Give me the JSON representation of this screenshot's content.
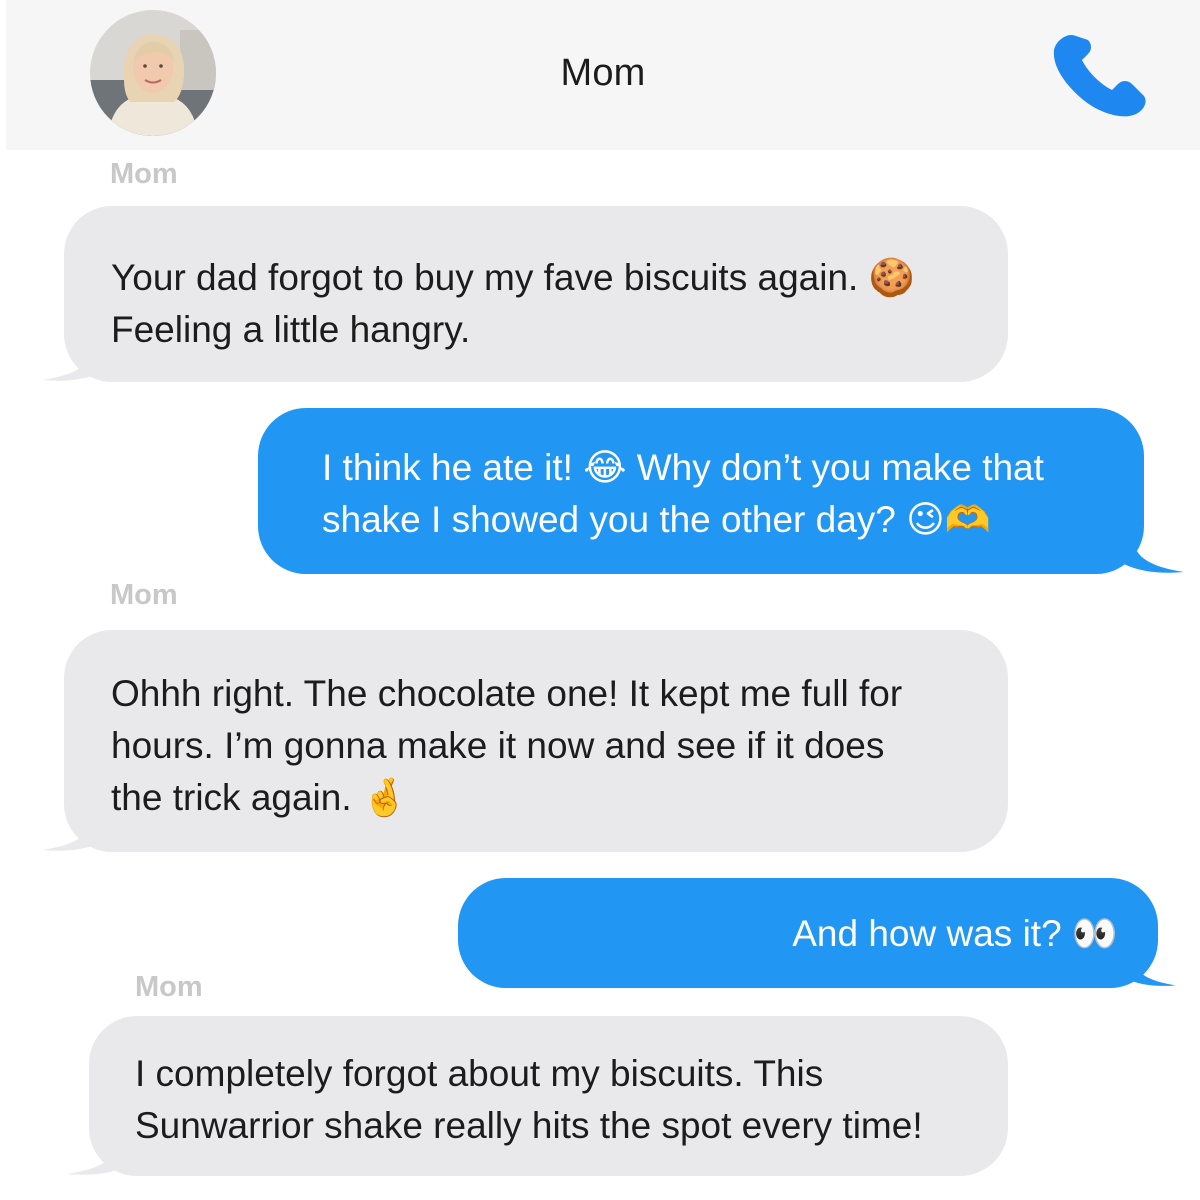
{
  "header": {
    "contact_name": "Mom",
    "call_icon": "phone-icon",
    "avatar_icon": "avatar-photo"
  },
  "colors": {
    "header_bg": "#f6f6f6",
    "received_bubble": "#e9e9eb",
    "sent_bubble": "#2196f3",
    "sender_label": "#c8c8c8",
    "call_icon": "#1e88f0"
  },
  "messages": [
    {
      "direction": "received",
      "sender": "Mom",
      "text": "Your dad forgot to buy my fave biscuits again. 🍪\nFeeling a little hangry."
    },
    {
      "direction": "sent",
      "text": "I think he ate it! 😂 Why don’t you make that\nshake I showed you the other day? 😉🫶"
    },
    {
      "direction": "received",
      "sender": "Mom",
      "text": "Ohhh right. The chocolate one! It kept me full for\nhours. I’m gonna make it now and see if it does\nthe trick again. 🤞"
    },
    {
      "direction": "sent",
      "text": "And how was it? 👀"
    },
    {
      "direction": "received",
      "sender": "Mom",
      "text": " I completely forgot about my biscuits. This\nSunwarrior shake really hits the spot every time!"
    }
  ]
}
